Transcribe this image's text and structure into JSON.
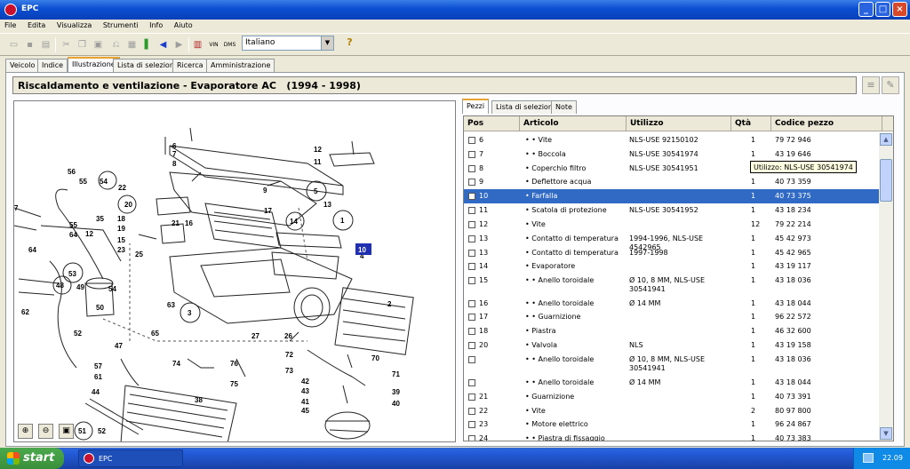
{
  "window": {
    "title": "EPC",
    "buttons": {
      "minimize": "_",
      "maximize": "□",
      "close": "×"
    }
  },
  "menu": [
    "File",
    "Edita",
    "Visualizza",
    "Strumenti",
    "Info",
    "Aiuto"
  ],
  "toolbar": {
    "icons": [
      "open-icon",
      "save-icon",
      "print-icon",
      "cut-icon",
      "copy-icon",
      "paste-icon",
      "undo-icon",
      "back-arrow-icon",
      "forward-arrow-icon",
      "bookmark-icon",
      "parts-list-icon",
      "vin-icon",
      "dms-icon"
    ],
    "vin_label": "VIN",
    "dms_label": "DMS",
    "language": "Italiano",
    "help_label": "?"
  },
  "tabs": [
    "Veicolo",
    "Indice",
    "Illustrazione",
    "Lista di selezione",
    "Ricerca",
    "Amministrazione"
  ],
  "header": {
    "title": "Riscaldamento e ventilazione - Evaporatore AC",
    "years": "(1994 - 1998)"
  },
  "subtabs": [
    "Pezzi",
    "Lista di selezione",
    "Note"
  ],
  "table": {
    "columns": [
      "Pos",
      "Articolo",
      "Utilizzo",
      "Qtà",
      "Codice pezzo"
    ],
    "rows": [
      {
        "pos": "6",
        "articolo": "• • Vite",
        "utilizzo": "NLS-USE 92150102",
        "qta": "1",
        "codice": "79 72 946"
      },
      {
        "pos": "7",
        "articolo": "• • Boccola",
        "utilizzo": "NLS-USE 30541974",
        "qta": "1",
        "codice": "43 19 646"
      },
      {
        "pos": "8",
        "articolo": "• Coperchio filtro",
        "utilizzo": "NLS-USE 30541951",
        "qta": "1",
        "codice": ""
      },
      {
        "pos": "9",
        "articolo": "• Deflettore acqua",
        "utilizzo": "",
        "qta": "1",
        "codice": "40 73 359"
      },
      {
        "pos": "10",
        "articolo": "• Farfalla",
        "utilizzo": "",
        "qta": "1",
        "codice": "40 73 375"
      },
      {
        "pos": "11",
        "articolo": "• Scatola di protezione",
        "utilizzo": "NLS-USE 30541952",
        "qta": "1",
        "codice": "43 18 234"
      },
      {
        "pos": "12",
        "articolo": "• Vite",
        "utilizzo": "",
        "qta": "12",
        "codice": "79 22 214"
      },
      {
        "pos": "13",
        "articolo": "• Contatto di temperatura",
        "utilizzo": "1994-1996, NLS-USE 4542965",
        "qta": "1",
        "codice": "45 42 973"
      },
      {
        "pos": "13",
        "articolo": "• Contatto di temperatura",
        "utilizzo": "1997-1998",
        "qta": "1",
        "codice": "45 42 965"
      },
      {
        "pos": "14",
        "articolo": "• Evaporatore",
        "utilizzo": "",
        "qta": "1",
        "codice": "43 19 117"
      },
      {
        "pos": "15",
        "articolo": "• • Anello toroidale",
        "utilizzo": "Ø 10, 8 MM, NLS-USE 30541941",
        "qta": "1",
        "codice": "43 18 036"
      },
      {
        "pos": "16",
        "articolo": "• • Anello toroidale",
        "utilizzo": "Ø 14 MM",
        "qta": "1",
        "codice": "43 18 044"
      },
      {
        "pos": "17",
        "articolo": "• • Guarnizione",
        "utilizzo": "",
        "qta": "1",
        "codice": "96 22 572"
      },
      {
        "pos": "18",
        "articolo": "• Piastra",
        "utilizzo": "",
        "qta": "1",
        "codice": "46 32 600"
      },
      {
        "pos": "20",
        "articolo": "• Valvola",
        "utilizzo": "NLS",
        "qta": "1",
        "codice": "43 19 158"
      },
      {
        "pos": "",
        "articolo": "• • Anello toroidale",
        "utilizzo": "Ø 10, 8 MM, NLS-USE 30541941",
        "qta": "1",
        "codice": "43 18 036"
      },
      {
        "pos": "",
        "articolo": "• • Anello toroidale",
        "utilizzo": "Ø 14 MM",
        "qta": "1",
        "codice": "43 18 044"
      },
      {
        "pos": "21",
        "articolo": "• Guarnizione",
        "utilizzo": "",
        "qta": "1",
        "codice": "40 73 391"
      },
      {
        "pos": "22",
        "articolo": "• Vite",
        "utilizzo": "",
        "qta": "2",
        "codice": "80 97 800"
      },
      {
        "pos": "23",
        "articolo": "• Motore elettrico",
        "utilizzo": "",
        "qta": "1",
        "codice": "96 24 867"
      },
      {
        "pos": "24",
        "articolo": "• • Piastra di fissaggio",
        "utilizzo": "",
        "qta": "1",
        "codice": "40 73 383"
      }
    ],
    "selected_pos": "10"
  },
  "tooltip": "Utilizzo: NLS-USE 30541974",
  "zoom_buttons": [
    "zoom-in-icon",
    "zoom-out-icon",
    "fit-icon"
  ],
  "diagram_labels": [
    "6",
    "7",
    "8",
    "12",
    "11",
    "5",
    "13",
    "17",
    "14",
    "1",
    "10",
    "4",
    "9",
    "56",
    "55",
    "54",
    "22",
    "20",
    "18",
    "19",
    "15",
    "23",
    "21",
    "16",
    "7",
    "35",
    "25",
    "55",
    "64",
    "12",
    "64",
    "53",
    "49",
    "48",
    "54",
    "62",
    "50",
    "52",
    "47",
    "63",
    "3",
    "2",
    "65",
    "27",
    "26",
    "57",
    "61",
    "74",
    "76",
    "75",
    "44",
    "38",
    "73",
    "72",
    "42",
    "43",
    "41",
    "45",
    "70",
    "71",
    "39",
    "40",
    "51",
    "52"
  ],
  "highlight_label": "10",
  "taskbar": {
    "start": "start",
    "item": "EPC",
    "clock": "22.09"
  },
  "colors": {
    "titlebar": "#0a4ed0",
    "selection": "#316ac5",
    "highlight": "#1f2fb0"
  }
}
